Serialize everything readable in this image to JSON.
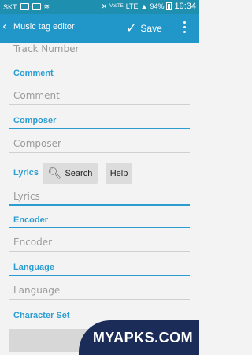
{
  "status_bar": {
    "carrier": "SKT",
    "volte": "VoLTE",
    "lte": "LTE",
    "battery_percent": "94%",
    "time": "19:34"
  },
  "app_bar": {
    "title": "Music tag editor",
    "save_label": "Save"
  },
  "form": {
    "track_number_placeholder": "Track Number",
    "comment_label": "Comment",
    "comment_placeholder": "Comment",
    "composer_label": "Composer",
    "composer_placeholder": "Composer",
    "lyrics_label": "Lyrics",
    "search_button": "Search",
    "help_button": "Help",
    "lyrics_placeholder": "Lyrics",
    "encoder_label": "Encoder",
    "encoder_placeholder": "Encoder",
    "language_label": "Language",
    "language_placeholder": "Language",
    "character_set_label": "Character Set"
  },
  "watermark": "MYAPKS.COM",
  "colors": {
    "status_bar": "#1f8fb0",
    "app_bar": "#2196c9",
    "accent": "#2c9dd1",
    "watermark_bg": "#1c2c58"
  }
}
